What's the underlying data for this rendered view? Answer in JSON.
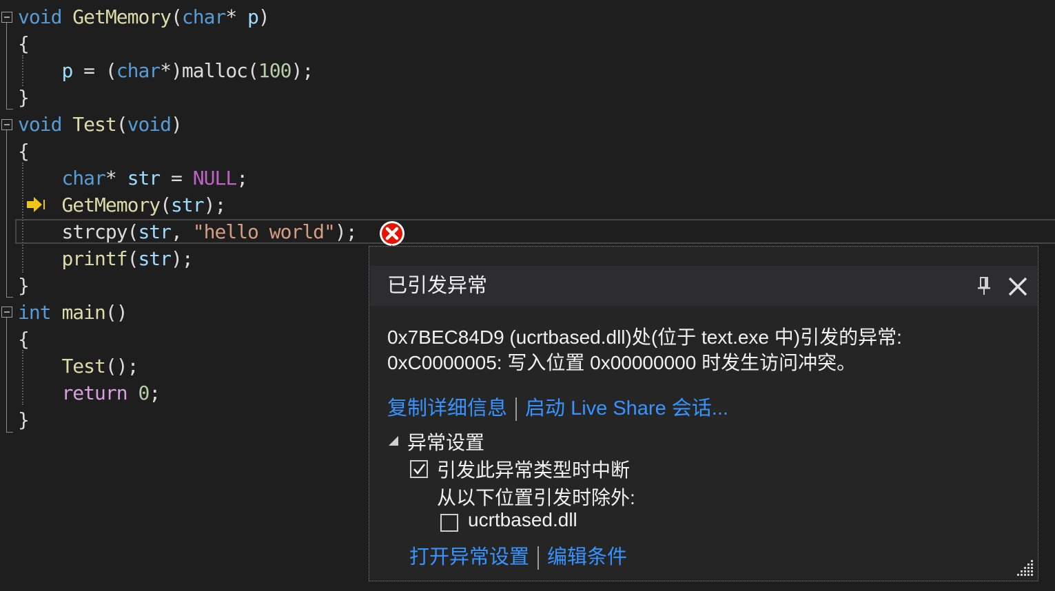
{
  "editor": {
    "lines": [
      [
        {
          "t": "void",
          "c": "kw"
        },
        {
          "t": " ",
          "c": "plain"
        },
        {
          "t": "GetMemory",
          "c": "fn"
        },
        {
          "t": "(",
          "c": "plain"
        },
        {
          "t": "char",
          "c": "kw"
        },
        {
          "t": "* ",
          "c": "plain"
        },
        {
          "t": "p",
          "c": "var"
        },
        {
          "t": ")",
          "c": "plain"
        }
      ],
      [
        {
          "t": "{",
          "c": "plain"
        }
      ],
      [
        {
          "t": "    ",
          "c": "plain"
        },
        {
          "t": "p",
          "c": "var"
        },
        {
          "t": " = (",
          "c": "plain"
        },
        {
          "t": "char",
          "c": "kw"
        },
        {
          "t": "*)",
          "c": "plain"
        },
        {
          "t": "malloc",
          "c": "plain"
        },
        {
          "t": "(",
          "c": "plain"
        },
        {
          "t": "100",
          "c": "num"
        },
        {
          "t": ");",
          "c": "plain"
        }
      ],
      [
        {
          "t": "}",
          "c": "plain"
        }
      ],
      [
        {
          "t": "void",
          "c": "kw"
        },
        {
          "t": " ",
          "c": "plain"
        },
        {
          "t": "Test",
          "c": "fn"
        },
        {
          "t": "(",
          "c": "plain"
        },
        {
          "t": "void",
          "c": "kw"
        },
        {
          "t": ")",
          "c": "plain"
        }
      ],
      [
        {
          "t": "{",
          "c": "plain"
        }
      ],
      [
        {
          "t": "    ",
          "c": "plain"
        },
        {
          "t": "char",
          "c": "kw"
        },
        {
          "t": "* ",
          "c": "plain"
        },
        {
          "t": "str",
          "c": "var"
        },
        {
          "t": " = ",
          "c": "plain"
        },
        {
          "t": "NULL",
          "c": "macro"
        },
        {
          "t": ";",
          "c": "plain"
        }
      ],
      [
        {
          "t": "    ",
          "c": "plain"
        },
        {
          "t": "GetMemory",
          "c": "fn"
        },
        {
          "t": "(",
          "c": "plain"
        },
        {
          "t": "str",
          "c": "var"
        },
        {
          "t": ");",
          "c": "plain"
        }
      ],
      [
        {
          "t": "    ",
          "c": "plain"
        },
        {
          "t": "strcpy",
          "c": "plain"
        },
        {
          "t": "(",
          "c": "plain"
        },
        {
          "t": "str",
          "c": "var"
        },
        {
          "t": ", ",
          "c": "plain"
        },
        {
          "t": "\"hello world\"",
          "c": "str"
        },
        {
          "t": ");",
          "c": "plain"
        }
      ],
      [
        {
          "t": "    ",
          "c": "plain"
        },
        {
          "t": "printf",
          "c": "fn"
        },
        {
          "t": "(",
          "c": "plain"
        },
        {
          "t": "str",
          "c": "var"
        },
        {
          "t": ");",
          "c": "plain"
        }
      ],
      [
        {
          "t": "}",
          "c": "plain"
        }
      ],
      [
        {
          "t": "int",
          "c": "kw"
        },
        {
          "t": " ",
          "c": "plain"
        },
        {
          "t": "main",
          "c": "fn"
        },
        {
          "t": "()",
          "c": "plain"
        }
      ],
      [
        {
          "t": "{",
          "c": "plain"
        }
      ],
      [
        {
          "t": "    ",
          "c": "plain"
        },
        {
          "t": "Test",
          "c": "fn"
        },
        {
          "t": "();",
          "c": "plain"
        }
      ],
      [
        {
          "t": "    ",
          "c": "plain"
        },
        {
          "t": "return",
          "c": "ctrl"
        },
        {
          "t": " ",
          "c": "plain"
        },
        {
          "t": "0",
          "c": "num"
        },
        {
          "t": ";",
          "c": "plain"
        }
      ],
      [
        {
          "t": "}",
          "c": "plain"
        }
      ]
    ]
  },
  "exception_popup": {
    "title": "已引发异常",
    "message_line1": "0x7BEC84D9 (ucrtbased.dll)处(位于 text.exe 中)引发的异常:",
    "message_line2": "0xC0000005: 写入位置 0x00000000 时发生访问冲突。",
    "copy_details_link": "复制详细信息",
    "live_share_link": "启动 Live Share 会话...",
    "settings_section_label": "异常设置",
    "break_checkbox_label": "引发此异常类型时中断",
    "break_checkbox_checked": true,
    "except_label": "从以下位置引发时除外:",
    "module_checkbox_label": "ucrtbased.dll",
    "module_checkbox_checked": false,
    "open_settings_link": "打开异常设置",
    "edit_conditions_link": "编辑条件",
    "pin_icon": "pin-icon",
    "close_icon": "close-icon",
    "error_icon": "error-icon"
  },
  "colors": {
    "background": "#1e1e1e",
    "keyword": "#569cd6",
    "function": "#dcdcaa",
    "variable": "#9cdcfe",
    "string": "#d69d85",
    "number": "#b5cea8",
    "macro": "#bd63c5",
    "link": "#3794ff",
    "error": "#e51400"
  }
}
